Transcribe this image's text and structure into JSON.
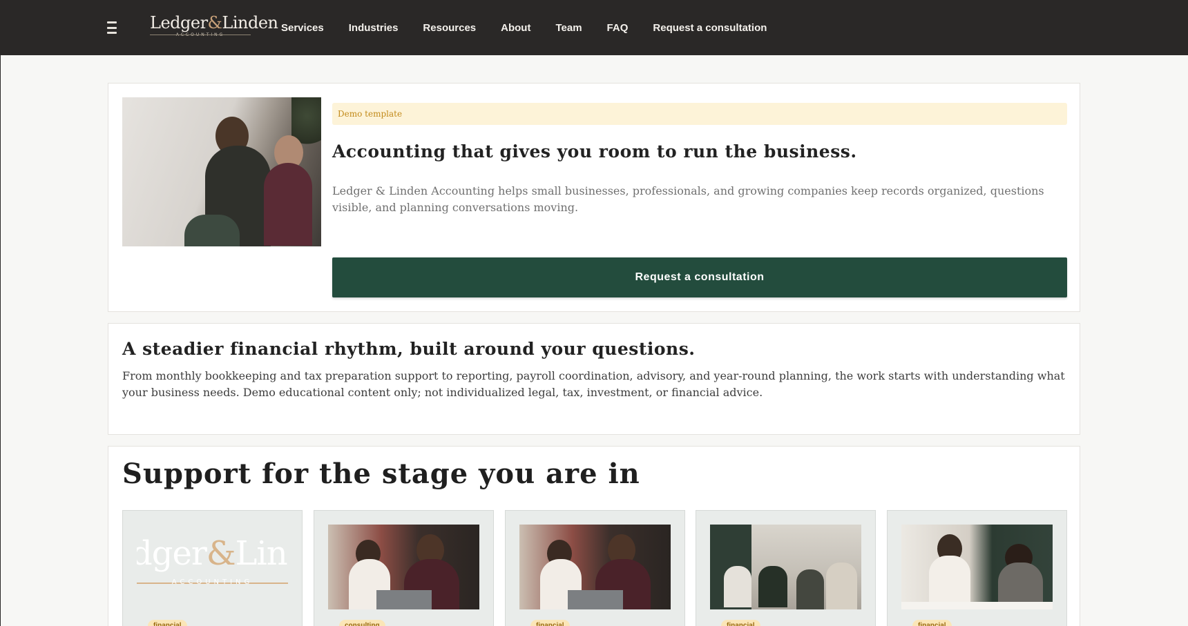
{
  "nav": {
    "logo_word_left": "Ledger",
    "logo_amp": "&",
    "logo_word_right": "Linden",
    "logo_sub": "ACCOUNTING",
    "links": [
      "Services",
      "Industries",
      "Resources",
      "About",
      "Team",
      "FAQ",
      "Request a consultation"
    ]
  },
  "hero": {
    "badge": "Demo template",
    "title": "Accounting that gives you room to run the business.",
    "description": "Ledger & Linden Accounting helps small businesses, professionals, and growing companies keep records organized, questions visible, and planning conversations moving.",
    "cta_label": "Request a consultation"
  },
  "steady": {
    "title": "A steadier financial rhythm, built around your questions.",
    "description": "From monthly bookkeeping and tax preparation support to reporting, payroll coordination, advisory, and year-round planning, the work starts with understanding what your business needs. Demo educational content only; not individualized legal, tax, investment, or financial advice."
  },
  "support": {
    "title": "Support for the stage you are in",
    "card_logo": {
      "left": "dger",
      "amp": "&",
      "right": "Lind",
      "sub": "ACCOUNTING"
    },
    "cards": [
      {
        "tag": "financial"
      },
      {
        "tag": "consulting"
      },
      {
        "tag": "financial"
      },
      {
        "tag": "financial"
      },
      {
        "tag": "financial"
      }
    ]
  },
  "colors": {
    "nav_bg": "#2a2827",
    "primary_green": "#234c3d",
    "badge_bg": "#fdf3d8",
    "badge_text": "#c28a1a",
    "tag_bg": "#fbe6b7"
  }
}
